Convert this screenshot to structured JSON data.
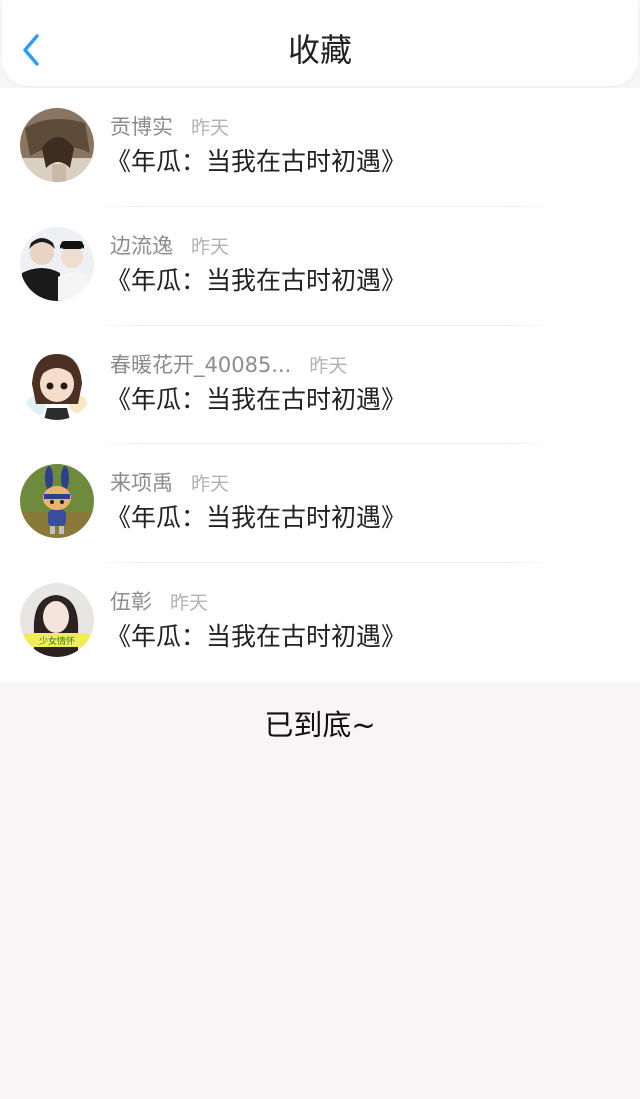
{
  "header": {
    "title": "收藏",
    "back_icon": "chevron-left-icon",
    "accent_color": "#2b9cf2"
  },
  "items": [
    {
      "username": "贡博实",
      "time": "昨天",
      "title": "《年瓜：当我在古时初遇》",
      "avatar": "avatar-girl-painting"
    },
    {
      "username": "边流逸",
      "time": "昨天",
      "title": "《年瓜：当我在古时初遇》",
      "avatar": "avatar-couple-photo"
    },
    {
      "username": "春暖花开_40085...",
      "time": "昨天",
      "title": "《年瓜：当我在古时初遇》",
      "avatar": "avatar-cartoon-girl"
    },
    {
      "username": "来项禹",
      "time": "昨天",
      "title": "《年瓜：当我在古时初遇》",
      "avatar": "avatar-bunny-figure"
    },
    {
      "username": "伍彰",
      "time": "昨天",
      "title": "《年瓜：当我在古时初遇》",
      "avatar": "avatar-girl-sticker"
    }
  ],
  "footer": {
    "end_text": "已到底~"
  }
}
